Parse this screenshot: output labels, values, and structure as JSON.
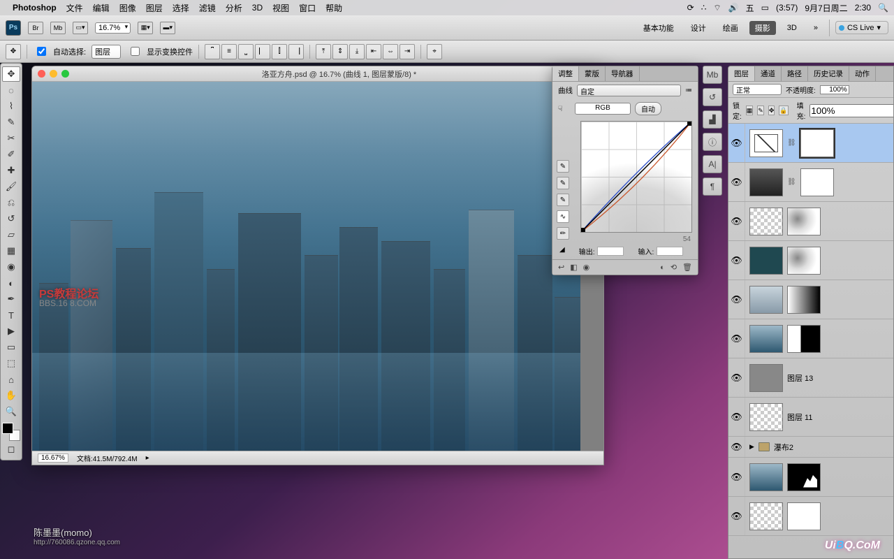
{
  "menu": {
    "app": "Photoshop",
    "items": [
      "文件",
      "编辑",
      "图像",
      "图层",
      "选择",
      "滤镜",
      "分析",
      "3D",
      "视图",
      "窗口",
      "帮助"
    ],
    "right": {
      "input": "五",
      "battery": "(3:57)",
      "date": "9月7日周二",
      "time": "2:30"
    }
  },
  "optbar": {
    "zoom": "16.7%",
    "workspaces": [
      "基本功能",
      "设计",
      "绘画",
      "摄影",
      "3D"
    ],
    "active_ws": "摄影",
    "cslive": "CS Live"
  },
  "optbar2": {
    "autosel_label": "自动选择:",
    "autosel_mode": "图层",
    "show_transform": "显示变换控件"
  },
  "doc": {
    "title": "洛亚方舟.psd @ 16.7% (曲线 1, 图层蒙版/8) *",
    "zoom": "16.67%",
    "docinfo": "文档:41.5M/792.4M",
    "watermark1": "PS教程论坛",
    "watermark2": "BBS.16  8.COM"
  },
  "adjust": {
    "tabs": [
      "调整",
      "蒙版",
      "导航器"
    ],
    "label": "曲线",
    "preset": "自定",
    "channel": "RGB",
    "auto": "自动",
    "output_label": "输出:",
    "input_label": "输入:",
    "readout": "54"
  },
  "layers": {
    "tabs": [
      "图层",
      "通道",
      "路径",
      "历史记录",
      "动作"
    ],
    "blend": "正常",
    "opacity_label": "不透明度:",
    "opacity": "100%",
    "lock_label": "锁定:",
    "fill_label": "填充:",
    "fill": "100%",
    "items": [
      {
        "name": "",
        "selected": true
      },
      {
        "name": ""
      },
      {
        "name": ""
      },
      {
        "name": ""
      },
      {
        "name": ""
      },
      {
        "name": ""
      },
      {
        "name": "图层 13"
      },
      {
        "name": "图层 11"
      },
      {
        "name": "瀑布2",
        "folder": true
      },
      {
        "name": ""
      },
      {
        "name": ""
      }
    ]
  },
  "credit": {
    "name": "陈墨墨(momo)",
    "url": "http://760086.qzone.qq.com"
  },
  "brand": "UiBQ.CoM"
}
